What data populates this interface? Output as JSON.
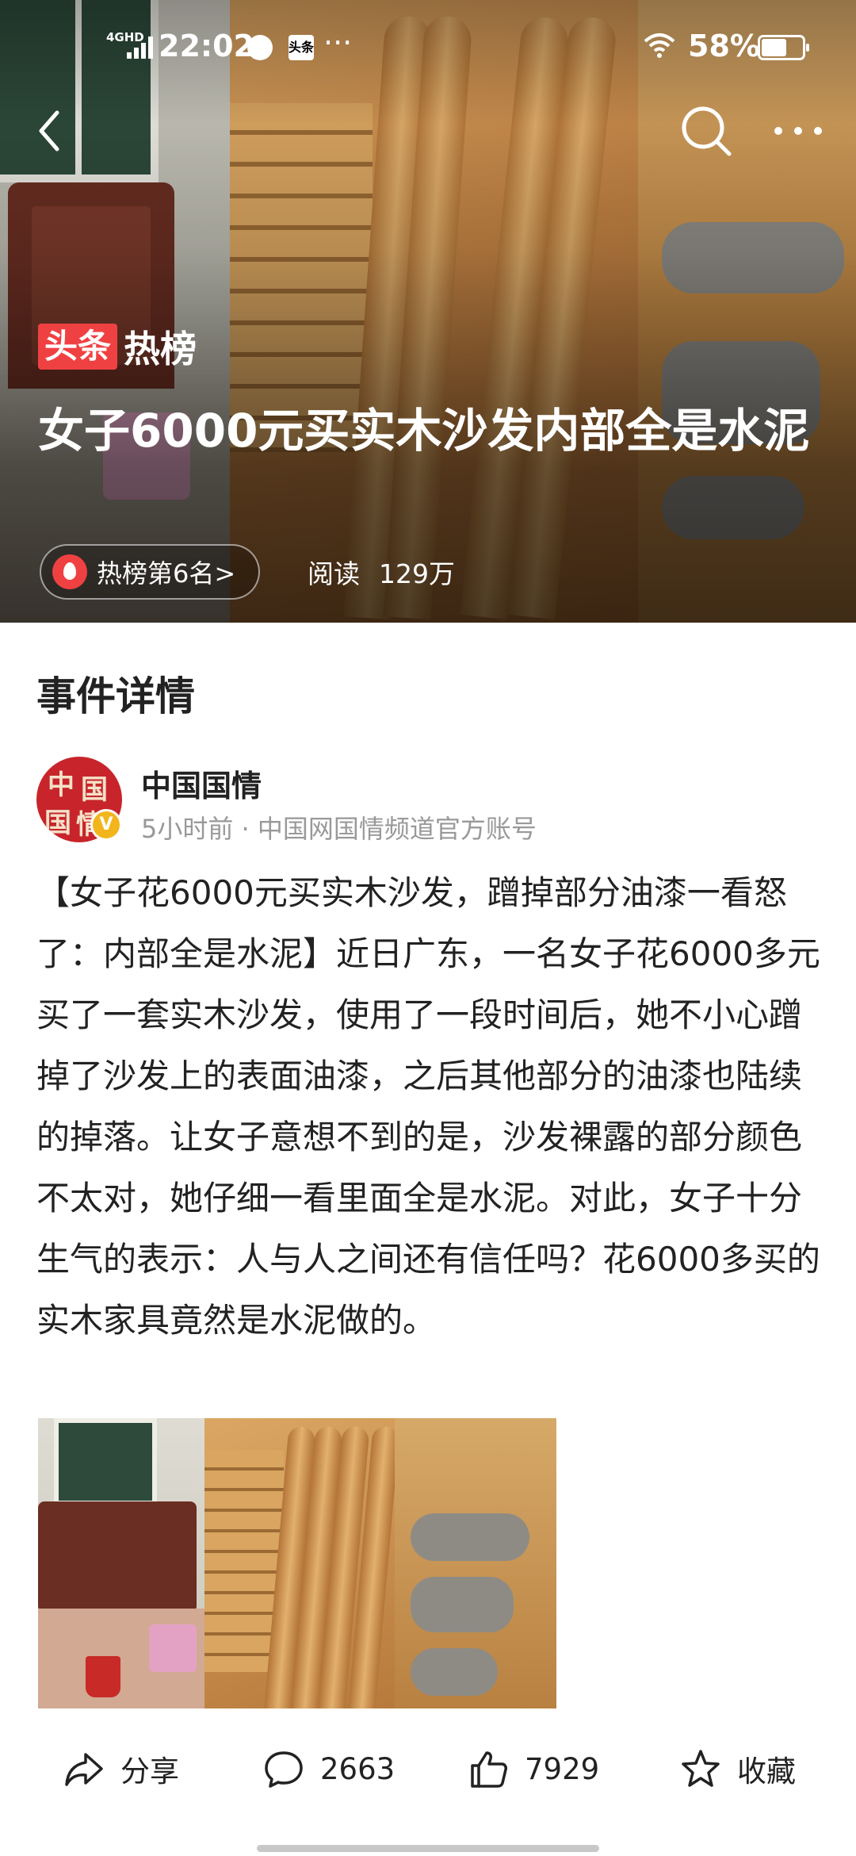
{
  "status_bar": {
    "network": "4GHD",
    "time": "22:02",
    "app_badge": "头条",
    "more": "···",
    "battery": "58%"
  },
  "hero": {
    "brand_tag": "头条",
    "brand_text": "热榜",
    "title": "女子6000元买实木沙发内部全是水泥",
    "rank": "热榜第6名>",
    "read_label": "阅读",
    "read_count": "129万"
  },
  "section": {
    "title": "事件详情"
  },
  "author": {
    "avatar_chars": [
      "中",
      "国",
      "国",
      "情"
    ],
    "verified_mark": "V",
    "name": "中国国情",
    "meta": "5小时前 · 中国网国情频道官方账号"
  },
  "article": {
    "body": "【女子花6000元买实木沙发，蹭掉部分油漆一看怒了：内部全是水泥】近日广东，一名女子花6000多元买了一套实木沙发，使用了一段时间后，她不小心蹭掉了沙发上的表面油漆，之后其他部分的油漆也陆续的掉落。让女子意想不到的是，沙发裸露的部分颜色不太对，她仔细一看里面全是水泥。对此，女子十分生气的表示：人与人之间还有信任吗？花6000多买的实木家具竟然是水泥做的。"
  },
  "actions": {
    "share": "分享",
    "comments": "2663",
    "likes": "7929",
    "favorite": "收藏"
  },
  "icons": {
    "back": "back-arrow-icon",
    "search": "search-icon",
    "more": "more-dots-icon",
    "share": "share-arrow-icon",
    "comment": "comment-bubble-icon",
    "like": "thumbs-up-icon",
    "favorite": "star-icon",
    "fire": "fire-icon"
  },
  "colors": {
    "brand_red": "#f04142",
    "text": "#222222",
    "meta": "#999999"
  }
}
